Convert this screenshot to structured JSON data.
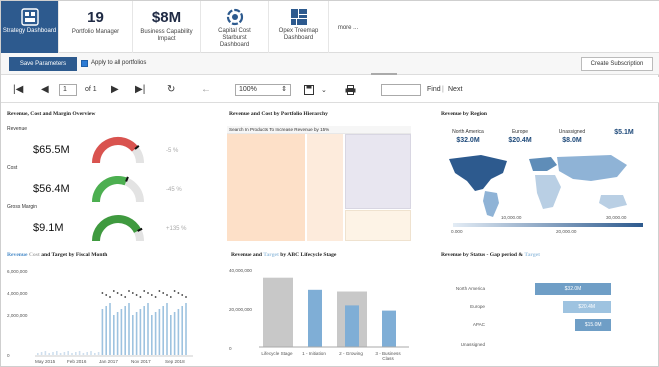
{
  "tiles": [
    {
      "big": "",
      "label": "Strategy Dashboard",
      "icon": "dashboard-icon",
      "active": true
    },
    {
      "big": "19",
      "label": "Portfolio Manager"
    },
    {
      "big": "$8M",
      "label": "Business Capability Impact"
    },
    {
      "big": "",
      "label": "Capital Cost Starburst Dashboard",
      "icon": "starburst-icon"
    },
    {
      "big": "",
      "label": "Opex Treemap Dashboard",
      "icon": "treemap-icon"
    },
    {
      "big": "",
      "label": "more ...",
      "icon": ""
    }
  ],
  "params": {
    "save_label": "Save Parameters",
    "apply_all_label": "Apply to all portfolios",
    "apply_all_checked": true,
    "subscribe_label": "Create Subscription"
  },
  "toolbar": {
    "page": "1",
    "of_label": "of 1",
    "zoom": "100%",
    "find_label": "Find",
    "separator": "|",
    "next_label": "Next",
    "find_value": ""
  },
  "panels": {
    "kpi_title": "Revenue, Cost and Margin Overview",
    "treemap_title": "Revenue and Cost by Portfolio Hierarchy",
    "treemap_cell_label": "Search In Products To Increase Revenue by 15%",
    "map_title": "Revenue by Region",
    "fiscal_title_part1": "Revenue",
    "fiscal_title_part2": "Cost",
    "fiscal_title_part3": "and Target by Fiscal Month",
    "lifecycle_title_part1": "Revenue and",
    "lifecycle_title_part2": "Target",
    "lifecycle_title_part3": "by ABC Lifecycle Stage",
    "status_title_part1": "Revenue by Status - Gap period &",
    "status_title_part2": "Target"
  },
  "kpis": [
    {
      "label": "Revenue",
      "value": "$65.5M",
      "pct": "-5 %",
      "level": 0.78,
      "color": "#d9534f"
    },
    {
      "label": "Cost",
      "value": "$56.4M",
      "pct": "-45 %",
      "level": 0.62,
      "color": "#4caf50"
    },
    {
      "label": "Gross Margin",
      "value": "$9.1M",
      "pct": "+135 %",
      "level": 0.85,
      "color": "#3f9a3f"
    }
  ],
  "map": {
    "regions": [
      {
        "name": "North America",
        "value": "$32.0M"
      },
      {
        "name": "Europe",
        "value": "$20.4M"
      },
      {
        "name": "Unassigned",
        "value": "$8.0M"
      },
      {
        "name": "",
        "value": "$5.1M"
      }
    ],
    "legend_ticks": [
      "0.000",
      "10,000.00",
      "20,000.00",
      "30,000.00"
    ]
  },
  "fiscal": {
    "y_ticks": [
      "6,000,000",
      "4,000,000",
      "2,000,000",
      "0"
    ],
    "x_ticks": [
      "May 2015",
      "Feb 2016",
      "Jan 2017",
      "Nov 2017",
      "Sep 2018"
    ]
  },
  "chart_data": [
    {
      "type": "bar",
      "title": "Revenue and Target by ABC Lifecycle Stage",
      "categories": [
        "Lifecycle Stage",
        "1 - Initiation",
        "2 - Growing",
        "3 - Business Class"
      ],
      "series": [
        {
          "name": "Revenue",
          "values": [
            40000000,
            0,
            32000000,
            0
          ]
        },
        {
          "name": "Target",
          "values": [
            0,
            33000000,
            24000000,
            21000000
          ]
        }
      ],
      "y_ticks": [
        "40,000,000",
        "20,000,000",
        "0"
      ],
      "ylim": [
        0,
        45000000
      ]
    },
    {
      "type": "bar",
      "title": "Revenue by Status - Gap period & Target",
      "categories": [
        "North America",
        "Europe",
        "APAC",
        "Unassigned"
      ],
      "series": [
        {
          "name": "Revenue",
          "values": [
            32.0,
            20.4,
            15.0,
            0
          ]
        }
      ],
      "value_labels": [
        "$32.0M",
        "$20.4M",
        "$15.0M",
        ""
      ]
    }
  ]
}
